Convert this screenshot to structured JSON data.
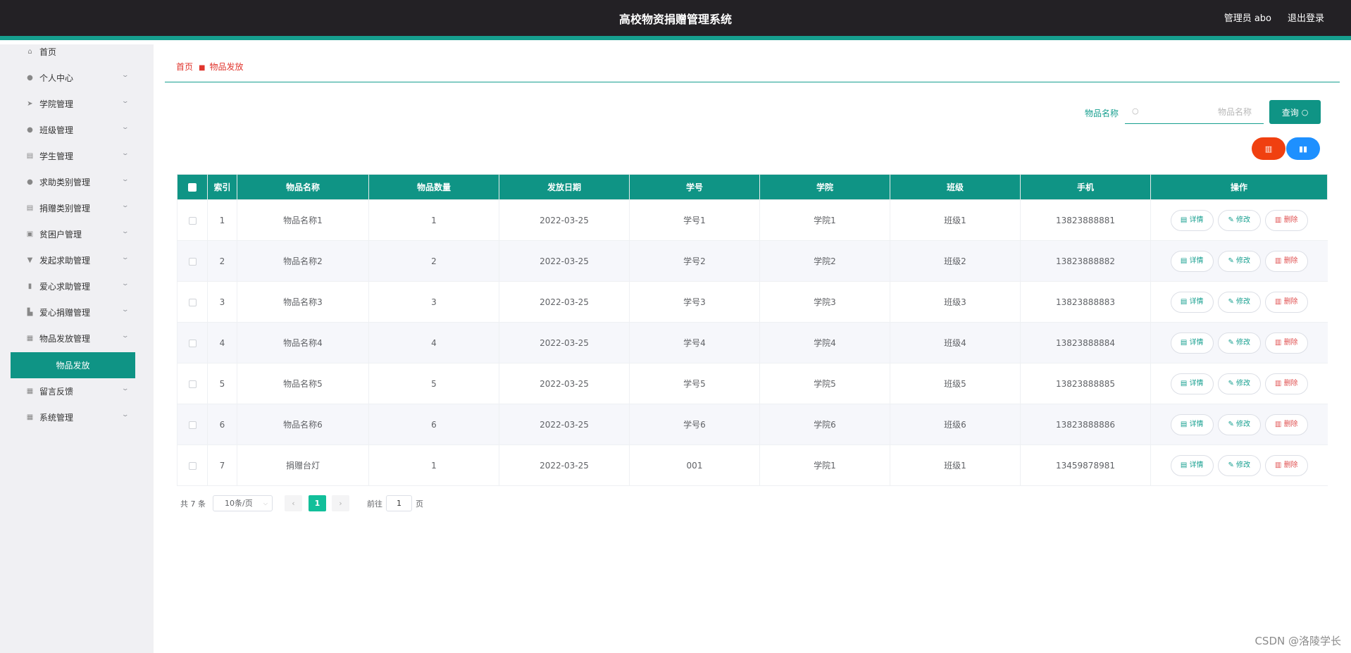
{
  "header": {
    "title": "高校物资捐赠管理系统",
    "admin": "管理员 abo",
    "logout": "退出登录"
  },
  "sidebar": {
    "items": [
      {
        "label": "首页",
        "icon": "home-icon",
        "glyph": "⌂",
        "has_children": false
      },
      {
        "label": "个人中心",
        "icon": "user-icon",
        "glyph": "●",
        "has_children": true
      },
      {
        "label": "学院管理",
        "icon": "send-icon",
        "glyph": "➤",
        "has_children": true
      },
      {
        "label": "班级管理",
        "icon": "location-icon",
        "glyph": "●",
        "has_children": true
      },
      {
        "label": "学生管理",
        "icon": "clipboard-icon",
        "glyph": "▤",
        "has_children": true
      },
      {
        "label": "求助类别管理",
        "icon": "user-icon",
        "glyph": "●",
        "has_children": true
      },
      {
        "label": "捐赠类别管理",
        "icon": "clipboard-icon",
        "glyph": "▤",
        "has_children": true
      },
      {
        "label": "贫困户管理",
        "icon": "document-icon",
        "glyph": "▣",
        "has_children": true
      },
      {
        "label": "发起求助管理",
        "icon": "trophy-icon",
        "glyph": "▼",
        "has_children": true
      },
      {
        "label": "爱心求助管理",
        "icon": "bar-chart-icon",
        "glyph": "▮",
        "has_children": true
      },
      {
        "label": "爱心捐赠管理",
        "icon": "chart-icon",
        "glyph": "▙",
        "has_children": true
      },
      {
        "label": "物品发放管理",
        "icon": "grid-icon",
        "glyph": "▦",
        "has_children": true
      },
      {
        "label": "物品发放",
        "icon": "",
        "glyph": "",
        "has_children": false,
        "active": true
      },
      {
        "label": "留言反馈",
        "icon": "grid-icon",
        "glyph": "▦",
        "has_children": true
      },
      {
        "label": "系统管理",
        "icon": "apps-icon",
        "glyph": "▦",
        "has_children": true
      }
    ]
  },
  "breadcrumb": {
    "home": "首页",
    "current": "物品发放"
  },
  "search": {
    "label": "物品名称",
    "placeholder": "物品名称",
    "button": "查询"
  },
  "actions": {
    "delete_icon": "trash-icon",
    "stats_icon": "bar-chart-icon"
  },
  "table": {
    "headers": [
      "索引",
      "物品名称",
      "物品数量",
      "发放日期",
      "学号",
      "学院",
      "班级",
      "手机",
      "操作"
    ],
    "rows": [
      {
        "index": "1",
        "name": "物品名称1",
        "qty": "1",
        "date": "2022-03-25",
        "student_no": "学号1",
        "college": "学院1",
        "class": "班级1",
        "phone": "13823888881"
      },
      {
        "index": "2",
        "name": "物品名称2",
        "qty": "2",
        "date": "2022-03-25",
        "student_no": "学号2",
        "college": "学院2",
        "class": "班级2",
        "phone": "13823888882"
      },
      {
        "index": "3",
        "name": "物品名称3",
        "qty": "3",
        "date": "2022-03-25",
        "student_no": "学号3",
        "college": "学院3",
        "class": "班级3",
        "phone": "13823888883"
      },
      {
        "index": "4",
        "name": "物品名称4",
        "qty": "4",
        "date": "2022-03-25",
        "student_no": "学号4",
        "college": "学院4",
        "class": "班级4",
        "phone": "13823888884"
      },
      {
        "index": "5",
        "name": "物品名称5",
        "qty": "5",
        "date": "2022-03-25",
        "student_no": "学号5",
        "college": "学院5",
        "class": "班级5",
        "phone": "13823888885"
      },
      {
        "index": "6",
        "name": "物品名称6",
        "qty": "6",
        "date": "2022-03-25",
        "student_no": "学号6",
        "college": "学院6",
        "class": "班级6",
        "phone": "13823888886"
      },
      {
        "index": "7",
        "name": "捐赠台灯",
        "qty": "1",
        "date": "2022-03-25",
        "student_no": "001",
        "college": "学院1",
        "class": "班级1",
        "phone": "13459878981"
      }
    ],
    "row_actions": {
      "detail": "详情",
      "edit": "修改",
      "delete": "删除"
    }
  },
  "pagination": {
    "total": "共 7 条",
    "page_size": "10条/页",
    "current_page": "1",
    "goto_label": "前往",
    "goto_value": "1",
    "page_word": "页"
  },
  "watermark": "CSDN @洛陵学长",
  "colors": {
    "topbar": "#232125",
    "accent": "#0f9485",
    "danger": "#f04010",
    "info": "#1e90ff",
    "page_active": "#12bf9a"
  }
}
